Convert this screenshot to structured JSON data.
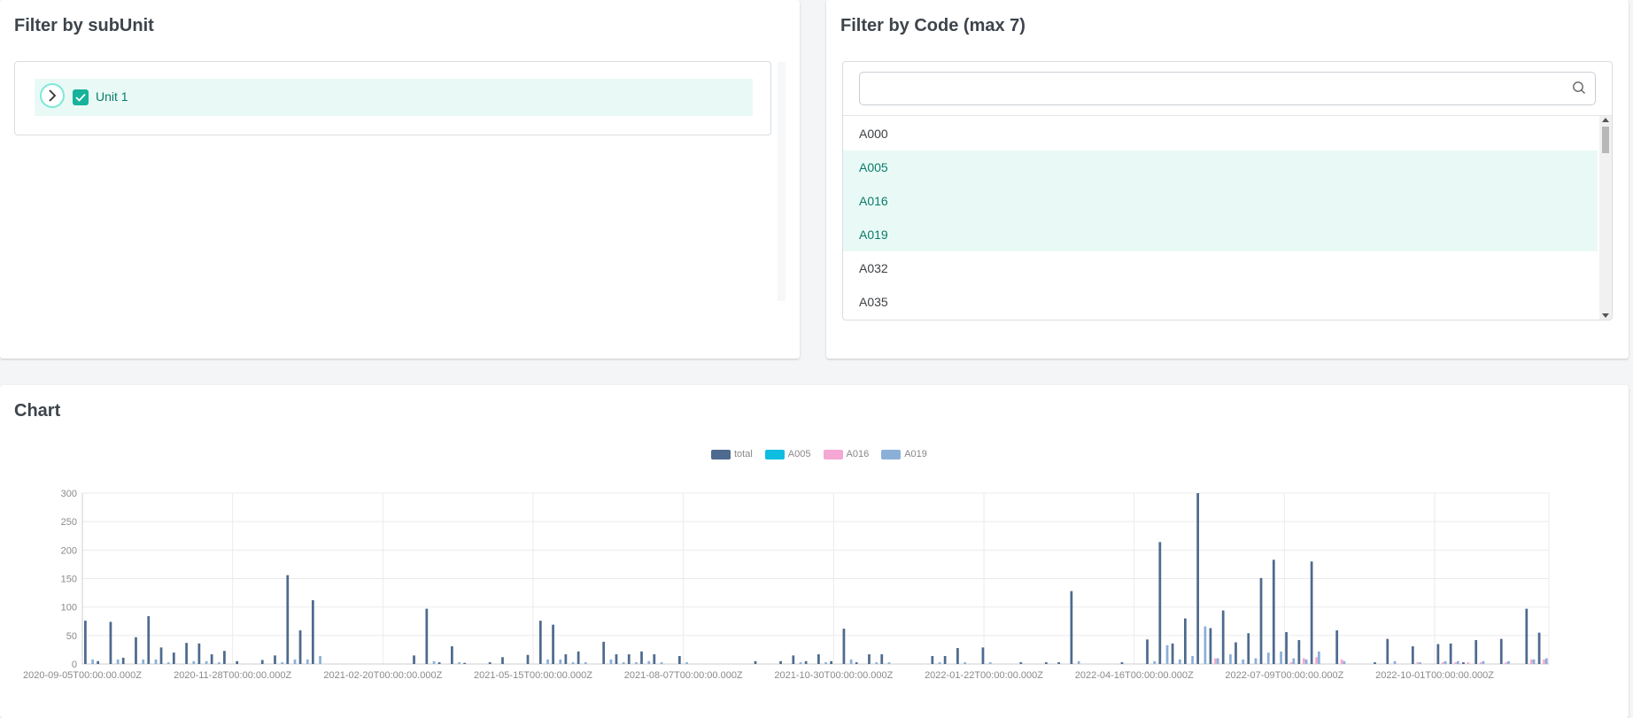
{
  "subunit_panel": {
    "title": "Filter by subUnit",
    "tree": [
      {
        "label": "Unit 1",
        "checked": true,
        "expanded": false
      }
    ]
  },
  "code_panel": {
    "title": "Filter by Code (max 7)",
    "search": {
      "value": "",
      "placeholder": ""
    },
    "codes": [
      {
        "label": "A000",
        "selected": false
      },
      {
        "label": "A005",
        "selected": true
      },
      {
        "label": "A016",
        "selected": true
      },
      {
        "label": "A019",
        "selected": true
      },
      {
        "label": "A032",
        "selected": false
      },
      {
        "label": "A035",
        "selected": false
      }
    ]
  },
  "chart_panel": {
    "title": "Chart"
  },
  "colors": {
    "accent": "#16b29a",
    "selected_bg": "#e9faf6",
    "selected_text": "#0b7a6a"
  },
  "icons": {
    "expand": "chevron-right-icon",
    "check": "check-icon",
    "search": "search-icon"
  },
  "chart_data": {
    "type": "bar",
    "legend": "top-center",
    "grid": true,
    "ylim": [
      0,
      300
    ],
    "yticks": [
      0,
      50,
      100,
      150,
      200,
      250,
      300
    ],
    "xtick_labels": [
      "2020-09-05T00:00:00.000Z",
      "2020-11-28T00:00:00.000Z",
      "2021-02-20T00:00:00.000Z",
      "2021-05-15T00:00:00.000Z",
      "2021-08-07T00:00:00.000Z",
      "2021-10-30T00:00:00.000Z",
      "2022-01-22T00:00:00.000Z",
      "2022-04-16T00:00:00.000Z",
      "2022-07-09T00:00:00.000Z",
      "2022-10-01T00:00:00.000Z"
    ],
    "series": [
      {
        "name": "total",
        "color": "#4e6a8e",
        "values": [
          76,
          5,
          74,
          11,
          47,
          84,
          29,
          20,
          37,
          36,
          17,
          23,
          5,
          0,
          7,
          15,
          156,
          59,
          112,
          0,
          0,
          0,
          0,
          0,
          0,
          0,
          15,
          97,
          3,
          31,
          2,
          0,
          3,
          12,
          0,
          16,
          76,
          69,
          17,
          22,
          0,
          39,
          17,
          17,
          22,
          17,
          0,
          14,
          0,
          0,
          0,
          0,
          0,
          5,
          0,
          5,
          15,
          5,
          17,
          5,
          62,
          3,
          17,
          17,
          0,
          0,
          0,
          14,
          14,
          28,
          0,
          29,
          0,
          0,
          3,
          0,
          3,
          3,
          128,
          0,
          0,
          0,
          3,
          0,
          43,
          214,
          36,
          80,
          300,
          63,
          94,
          38,
          54,
          151,
          183,
          56,
          42,
          180,
          0,
          59,
          0,
          0,
          3,
          44,
          0,
          31,
          0,
          35,
          36,
          3,
          42,
          0,
          44,
          0,
          97,
          55
        ]
      },
      {
        "name": "A005",
        "color": "#0fbde0",
        "values": [
          0,
          0,
          0,
          0,
          0,
          0,
          0,
          0,
          0,
          0,
          0,
          0,
          0,
          0,
          0,
          0,
          0,
          0,
          0,
          0,
          0,
          0,
          0,
          0,
          0,
          0,
          0,
          0,
          0,
          0,
          0,
          0,
          0,
          0,
          0,
          0,
          0,
          0,
          0,
          0,
          0,
          0,
          0,
          0,
          0,
          0,
          0,
          0,
          0,
          0,
          0,
          0,
          0,
          0,
          0,
          0,
          0,
          0,
          0,
          0,
          0,
          0,
          0,
          0,
          0,
          0,
          0,
          0,
          0,
          0,
          0,
          0,
          0,
          0,
          0,
          0,
          0,
          0,
          0,
          0,
          0,
          0,
          0,
          0,
          0,
          0,
          0,
          0,
          0,
          0,
          0,
          0,
          0,
          0,
          0,
          0,
          0,
          0,
          0,
          0,
          0,
          0,
          0,
          0,
          0,
          0,
          0,
          0,
          0,
          0,
          0,
          0,
          0,
          0,
          0,
          0
        ]
      },
      {
        "name": "A016",
        "color": "#f5a8d4",
        "values": [
          0,
          0,
          0,
          0,
          0,
          0,
          0,
          0,
          0,
          0,
          0,
          0,
          0,
          0,
          0,
          0,
          0,
          0,
          0,
          0,
          0,
          0,
          0,
          0,
          0,
          0,
          0,
          0,
          0,
          0,
          0,
          0,
          0,
          0,
          0,
          0,
          0,
          0,
          0,
          0,
          0,
          0,
          0,
          0,
          0,
          0,
          0,
          0,
          0,
          0,
          0,
          0,
          0,
          0,
          0,
          0,
          0,
          0,
          0,
          0,
          0,
          0,
          0,
          0,
          0,
          0,
          0,
          0,
          0,
          0,
          0,
          0,
          0,
          0,
          0,
          0,
          0,
          0,
          0,
          0,
          0,
          0,
          0,
          0,
          0,
          0,
          0,
          0,
          0,
          10,
          0,
          0,
          0,
          0,
          0,
          3,
          10,
          12,
          0,
          8,
          0,
          0,
          0,
          0,
          0,
          3,
          0,
          3,
          3,
          3,
          3,
          0,
          3,
          0,
          8,
          8
        ]
      },
      {
        "name": "A019",
        "color": "#8ab0d8",
        "values": [
          8,
          0,
          8,
          0,
          8,
          8,
          3,
          0,
          5,
          5,
          3,
          0,
          0,
          0,
          0,
          3,
          8,
          8,
          14,
          0,
          0,
          0,
          0,
          0,
          0,
          0,
          0,
          5,
          0,
          3,
          0,
          0,
          0,
          0,
          0,
          0,
          8,
          8,
          3,
          3,
          0,
          8,
          3,
          3,
          5,
          3,
          0,
          3,
          0,
          0,
          0,
          0,
          0,
          0,
          0,
          0,
          3,
          0,
          3,
          0,
          8,
          0,
          3,
          3,
          0,
          0,
          0,
          3,
          0,
          3,
          0,
          3,
          0,
          0,
          0,
          0,
          0,
          0,
          5,
          0,
          0,
          0,
          0,
          0,
          5,
          33,
          8,
          14,
          66,
          10,
          17,
          8,
          10,
          20,
          22,
          10,
          8,
          22,
          0,
          5,
          0,
          0,
          0,
          5,
          0,
          3,
          0,
          5,
          5,
          0,
          5,
          0,
          5,
          0,
          8,
          10
        ]
      }
    ]
  }
}
